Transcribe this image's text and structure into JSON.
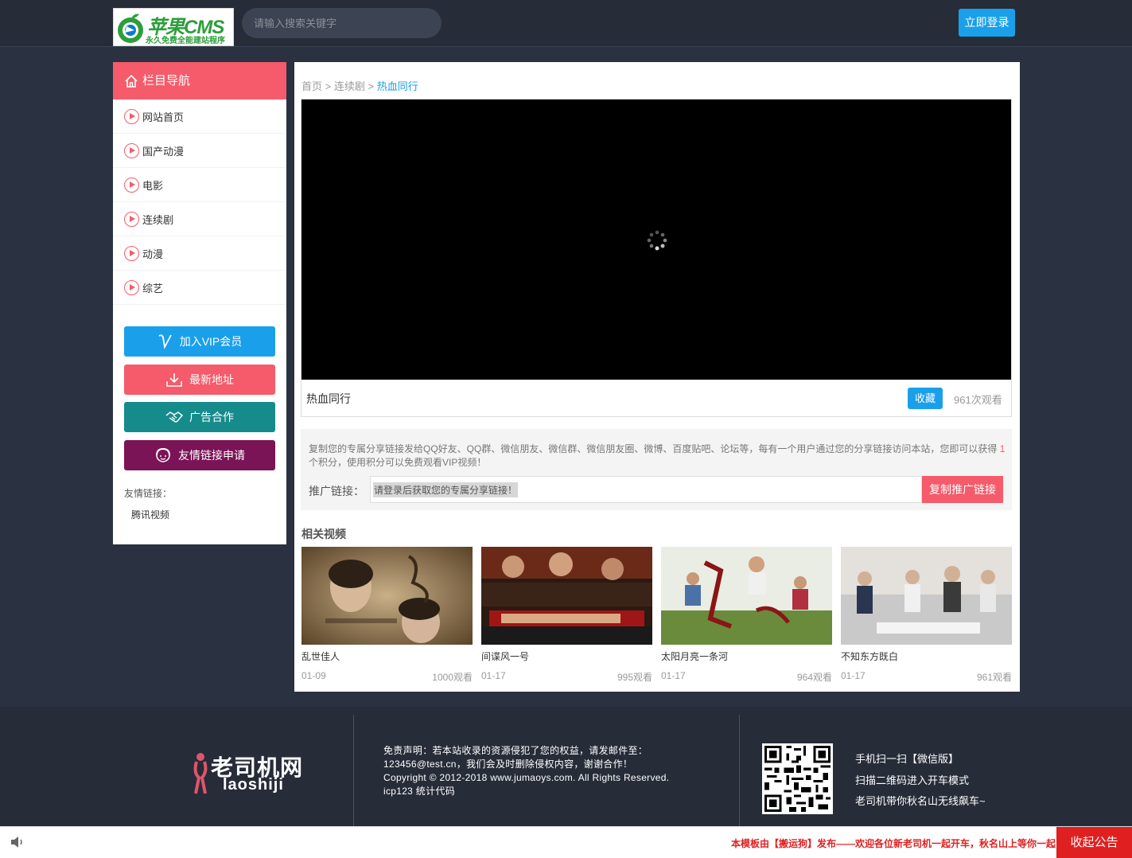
{
  "header": {
    "logo_brand": "苹果CMS",
    "logo_tagline": "永久免费全能建站程序",
    "search_placeholder": "请输入搜索关键字",
    "login_label": "立即登录"
  },
  "sidebar": {
    "title": "栏目导航",
    "items": [
      {
        "label": "网站首页"
      },
      {
        "label": "国产动漫"
      },
      {
        "label": "电影"
      },
      {
        "label": "连续剧"
      },
      {
        "label": "动漫"
      },
      {
        "label": "综艺"
      }
    ],
    "buttons": {
      "vip": "加入VIP会员",
      "address": "最新地址",
      "ad": "广告合作",
      "friend": "友情链接申请"
    },
    "friend_links_title": "友情链接：",
    "friend_links": [
      "腾讯视频"
    ]
  },
  "breadcrumb": {
    "home": "首页",
    "sep": ">",
    "category": "连续剧",
    "current": "热血同行"
  },
  "player": {
    "title": "热血同行",
    "favorite_label": "收藏",
    "views": "961次观看"
  },
  "share": {
    "desc_before": "复制您的专属分享链接发给QQ好友、QQ群、微信朋友、微信群、微信朋友圈、微博、百度贴吧、论坛等，每有一个用户通过您的分享链接访问本站，您即可以获得",
    "points": "1",
    "desc_after": "个积分，使用积分可以免费观看VIP视频！",
    "label": "推广链接：",
    "input_value": "请登录后获取您的专属分享链接！",
    "copy_label": "复制推广链接"
  },
  "related": {
    "title": "相关视频",
    "items": [
      {
        "name": "乱世佳人",
        "date": "01-09",
        "views": "1000观看"
      },
      {
        "name": "间谍风一号",
        "date": "01-17",
        "views": "995观看"
      },
      {
        "name": "太阳月亮一条河",
        "date": "01-17",
        "views": "964观看"
      },
      {
        "name": "不知东方既白",
        "date": "01-17",
        "views": "961观看"
      }
    ]
  },
  "footer": {
    "logo_cn": "老司机网",
    "logo_en": "laoshiji",
    "disclaimer_1": "免责声明：若本站收录的资源侵犯了您的权益，请发邮件至：",
    "disclaimer_2": "123456@test.cn，我们会及时删除侵权内容，谢谢合作！",
    "copyright": "Copyright © 2012-2018 www.jumaoys.com. All Rights Reserved.",
    "icp": "icp123 统计代码",
    "mobile_1": "手机扫一扫【微信版】",
    "mobile_2": "扫描二维码进入开车模式",
    "mobile_3": "老司机带你秋名山无线飙车~"
  },
  "notice": {
    "text": "本模板由【搬运狗】发布——欢迎各位新老司机一起开车，秋名山上等你一起",
    "close_label": "收起公告"
  },
  "colors": {
    "accent_blue": "#1aa0ea",
    "accent_red": "#f55b6a",
    "teal": "#168b8b",
    "purple": "#7b1457",
    "notice_red": "#e02020"
  }
}
